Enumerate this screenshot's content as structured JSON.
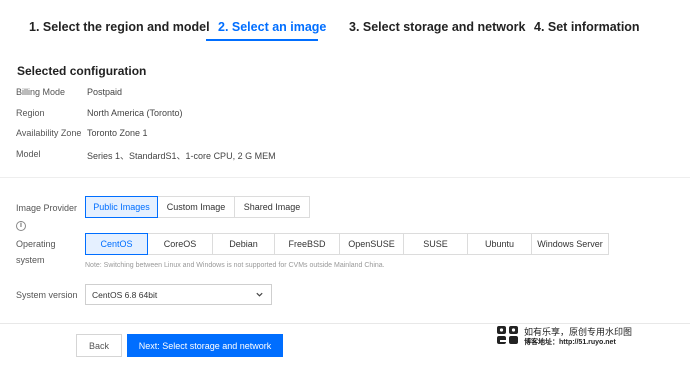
{
  "steps": [
    {
      "label": "1. Select the region and model"
    },
    {
      "label": "2. Select an image"
    },
    {
      "label": "3. Select storage and network"
    },
    {
      "label": "4. Set information"
    }
  ],
  "active_step": 1,
  "config": {
    "title": "Selected configuration",
    "rows": [
      {
        "label": "Billing Mode",
        "value": "Postpaid"
      },
      {
        "label": "Region",
        "value": "North America (Toronto)"
      },
      {
        "label": "Availability Zone",
        "value": "Toronto Zone 1"
      },
      {
        "label": "Model",
        "value": "Series 1、StandardS1、1-core CPU, 2 G MEM"
      }
    ]
  },
  "image_provider": {
    "label": "Image Provider",
    "info_symbol": "i",
    "options": [
      "Public Images",
      "Custom Image",
      "Shared Image"
    ],
    "selected": "Public Images"
  },
  "os": {
    "label": "Operating system",
    "options": [
      "CentOS",
      "CoreOS",
      "Debian",
      "FreeBSD",
      "OpenSUSE",
      "SUSE",
      "Ubuntu",
      "Windows Server"
    ],
    "selected": "CentOS",
    "note": "Note: Switching between Linux and Windows is not supported for CVMs outside Mainland China."
  },
  "system_version": {
    "label": "System version",
    "value": "CentOS 6.8 64bit"
  },
  "footer": {
    "back_label": "Back",
    "next_label": "Next: Select storage and network"
  },
  "watermark": {
    "line1": "如有乐享，原创专用水印图",
    "line2": "博客地址：http://51.ruyo.net"
  },
  "colors": {
    "accent": "#006eff",
    "selected_bg": "#e5f0ff"
  }
}
